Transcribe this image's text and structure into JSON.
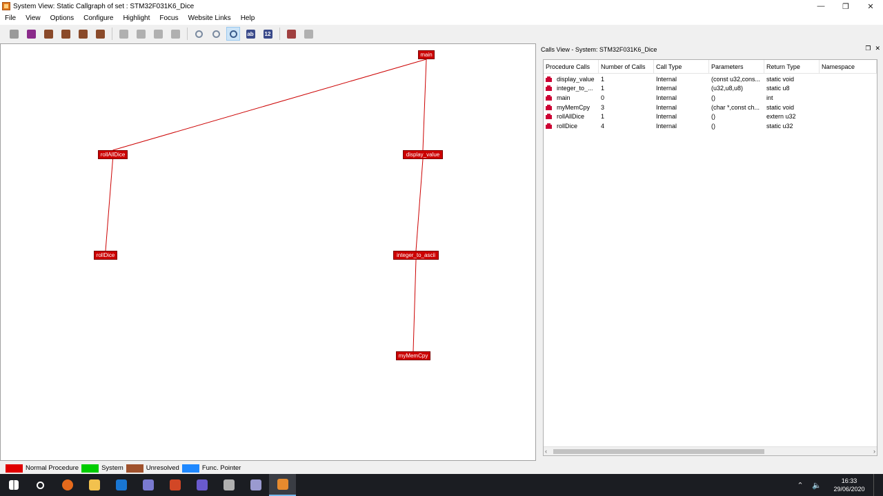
{
  "window": {
    "title": "System View: Static Callgraph of set : STM32F031K6_Dice",
    "minimize_icon": "minimize-icon",
    "restore_icon": "restore-icon",
    "close_icon": "close-icon",
    "minimize_glyph": "—",
    "restore_glyph": "❐",
    "close_glyph": "✕"
  },
  "menu": {
    "items": [
      "File",
      "View",
      "Options",
      "Configure",
      "Highlight",
      "Focus",
      "Website Links",
      "Help"
    ]
  },
  "toolbar": {
    "buttons": [
      {
        "name": "layout-grey-1-icon",
        "color": "#9a9a9a"
      },
      {
        "name": "layout-purple-icon",
        "color": "#8a2a8a"
      },
      {
        "name": "layout-brown-1-icon",
        "color": "#8a4a2a"
      },
      {
        "name": "layout-brown-2-icon",
        "color": "#8a4a2a"
      },
      {
        "name": "layout-brown-3-icon",
        "color": "#8a4a2a"
      },
      {
        "name": "layout-brown-4-icon",
        "color": "#8a4a2a"
      },
      {
        "name": "layout-grey-2-icon",
        "color": "#b0b0b0"
      },
      {
        "name": "layout-grey-3-icon",
        "color": "#b0b0b0"
      },
      {
        "name": "layout-grey-4-icon",
        "color": "#b0b0b0"
      },
      {
        "name": "layout-grey-5-icon",
        "color": "#b0b0b0"
      },
      {
        "name": "zoom-in-icon",
        "color": "#7a8aa0"
      },
      {
        "name": "zoom-out-icon",
        "color": "#7a8aa0"
      },
      {
        "name": "zoom-fit-icon",
        "color": "#3a5a8a"
      },
      {
        "name": "text-ab-icon",
        "color": "#3a4a8a"
      },
      {
        "name": "number-12-icon",
        "color": "#3a4a8a"
      },
      {
        "name": "highlight-pen-icon",
        "color": "#a04040"
      },
      {
        "name": "undo-icon",
        "color": "#b0b0b0"
      }
    ],
    "ab_label": "ab",
    "num_label": "12"
  },
  "graph": {
    "nodes": [
      {
        "id": "main",
        "label": "main"
      },
      {
        "id": "rollAllDice",
        "label": "rollAllDice"
      },
      {
        "id": "display_value",
        "label": "display_value"
      },
      {
        "id": "rollDice",
        "label": "rollDice"
      },
      {
        "id": "integer_to_ascii",
        "label": "integer_to_ascii"
      },
      {
        "id": "myMemCpy",
        "label": "myMemCpy"
      }
    ],
    "edges": [
      {
        "from": "main",
        "to": "rollAllDice"
      },
      {
        "from": "main",
        "to": "display_value"
      },
      {
        "from": "rollAllDice",
        "to": "rollDice"
      },
      {
        "from": "display_value",
        "to": "integer_to_ascii"
      },
      {
        "from": "integer_to_ascii",
        "to": "myMemCpy"
      }
    ],
    "edge_color": "#cc0000",
    "node_color": "#cc0000"
  },
  "calls_view": {
    "title": "Calls View - System: STM32F031K6_Dice",
    "columns": [
      "Procedure Calls",
      "Number of Calls",
      "Call Type",
      "Parameters",
      "Return Type",
      "Namespace"
    ],
    "rows": [
      {
        "proc": "display_value",
        "calls": "1",
        "type": "Internal",
        "params": "(const u32,cons...",
        "ret": "static void",
        "ns": ""
      },
      {
        "proc": "integer_to_...",
        "calls": "1",
        "type": "Internal",
        "params": "(u32,u8,u8)",
        "ret": "static u8",
        "ns": ""
      },
      {
        "proc": "main",
        "calls": "0",
        "type": "Internal",
        "params": "()",
        "ret": "int",
        "ns": ""
      },
      {
        "proc": "myMemCpy",
        "calls": "3",
        "type": "Internal",
        "params": "(char *,const ch...",
        "ret": "static void",
        "ns": ""
      },
      {
        "proc": "rollAllDice",
        "calls": "1",
        "type": "Internal",
        "params": "()",
        "ret": "extern u32",
        "ns": ""
      },
      {
        "proc": "rollDice",
        "calls": "4",
        "type": "Internal",
        "params": "()",
        "ret": "static u32",
        "ns": ""
      }
    ]
  },
  "legend": [
    {
      "label": "Normal Procedure",
      "color": "#e00000"
    },
    {
      "label": "System",
      "color": "#00cc00"
    },
    {
      "label": "Unresolved",
      "color": "#a0522d"
    },
    {
      "label": "Func. Pointer",
      "color": "#1e88ff"
    }
  ],
  "taskbar": {
    "apps": [
      {
        "name": "start-windows-icon",
        "color": "#ffffff"
      },
      {
        "name": "search-icon",
        "color": "#ffffff"
      },
      {
        "name": "firefox-icon",
        "color": "#e66a1c"
      },
      {
        "name": "file-explorer-icon",
        "color": "#f2c14e"
      },
      {
        "name": "outlook-icon",
        "color": "#1976d2"
      },
      {
        "name": "app-blue-icon",
        "color": "#7a7ad0"
      },
      {
        "name": "powerpoint-icon",
        "color": "#d24726"
      },
      {
        "name": "app-purple-icon",
        "color": "#6a5acd"
      },
      {
        "name": "app-tool-icon",
        "color": "#b0b0b0"
      },
      {
        "name": "settings-app-icon",
        "color": "#9a9ad0"
      },
      {
        "name": "understand-app-icon",
        "color": "#e68a2e"
      }
    ],
    "time": "16:33",
    "date": "29/06/2020"
  }
}
